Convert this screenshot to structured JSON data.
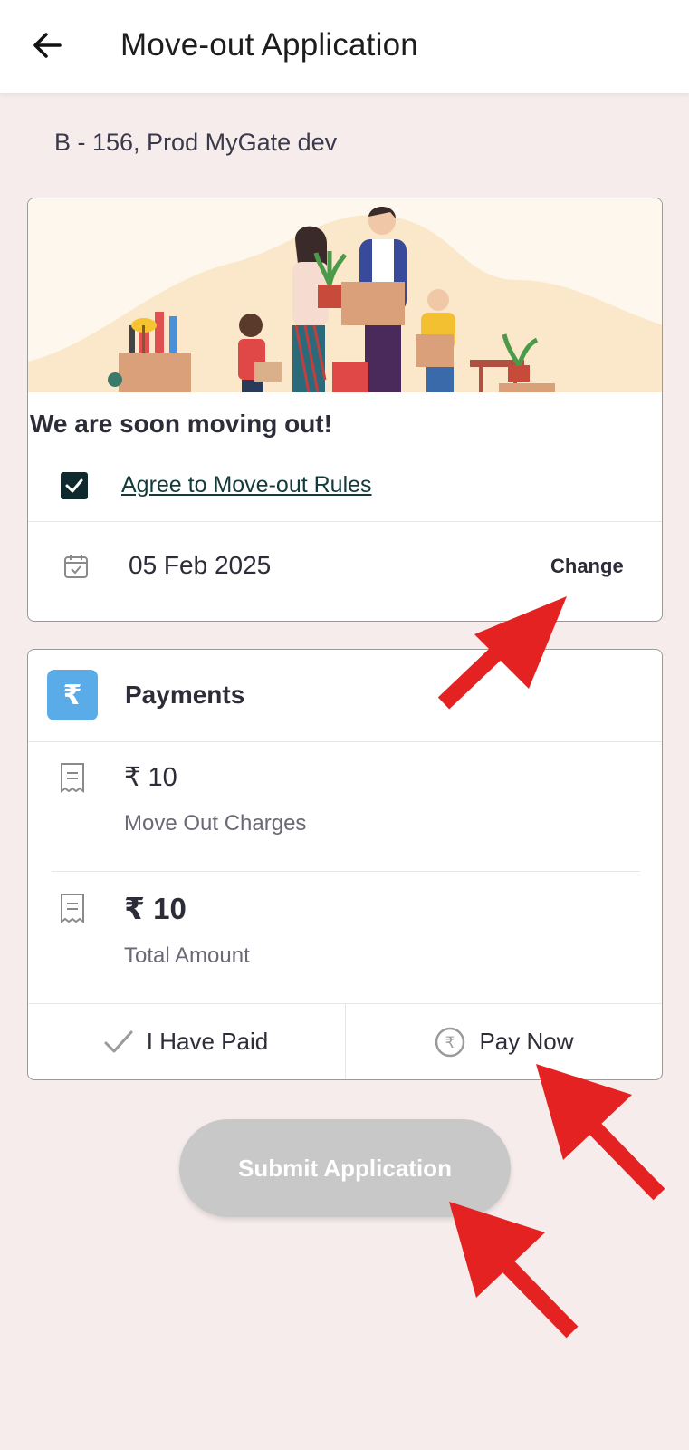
{
  "appbar": {
    "title": "Move-out Application",
    "back_icon": "arrow-left-icon"
  },
  "flat": {
    "label": "B - 156, Prod MyGate dev"
  },
  "move_card": {
    "heading": "We are soon moving out!",
    "agree_checked": true,
    "agree_label": "Agree to Move-out Rules",
    "date": "05 Feb 2025",
    "change_label": "Change"
  },
  "payments": {
    "heading": "Payments",
    "icon_symbol": "₹",
    "items": [
      {
        "amount": "₹ 10",
        "label": "Move Out Charges"
      },
      {
        "amount": "₹ 10",
        "label": "Total Amount"
      }
    ],
    "paid_label": "I Have Paid",
    "pay_now_label": "Pay Now"
  },
  "submit": {
    "label": "Submit Application"
  },
  "colors": {
    "background": "#f6ecec",
    "accent_blue": "#5aace8",
    "checkbox": "#0f2a2f",
    "submit_disabled": "#c8c8c8",
    "annotation_arrow": "#e42222"
  }
}
